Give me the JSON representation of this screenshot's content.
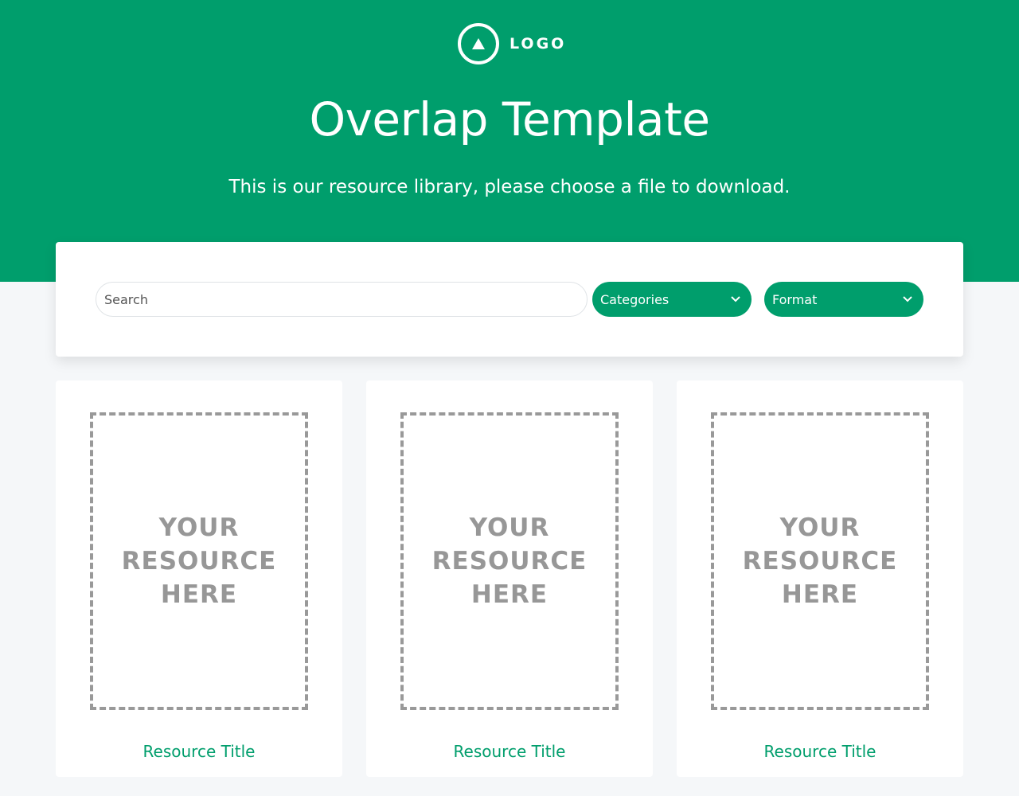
{
  "brand": {
    "logo_text": "LOGO",
    "color": "#009e6c"
  },
  "hero": {
    "title": "Overlap Template",
    "subtitle": "This is our resource library, please choose a file to download."
  },
  "filters": {
    "search_placeholder": "Search",
    "categories_label": "Categories",
    "format_label": "Format"
  },
  "resources": [
    {
      "placeholder_lines": [
        "YOUR",
        "RESOURCE",
        "HERE"
      ],
      "title": "Resource Title"
    },
    {
      "placeholder_lines": [
        "YOUR",
        "RESOURCE",
        "HERE"
      ],
      "title": "Resource Title"
    },
    {
      "placeholder_lines": [
        "YOUR",
        "RESOURCE",
        "HERE"
      ],
      "title": "Resource Title"
    }
  ]
}
